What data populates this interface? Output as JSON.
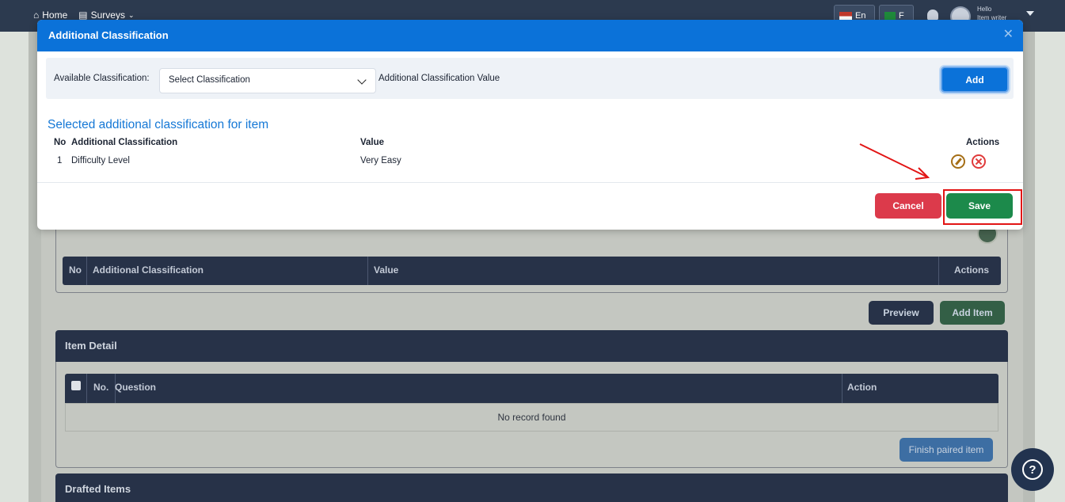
{
  "topbar": {
    "home": "Home",
    "surveys": "Surveys",
    "lang_en": "En",
    "lang_other": "F",
    "user_hello": "Hello",
    "user_name": "Item writer"
  },
  "background": {
    "table1_headers": [
      "No",
      "Additional Classification",
      "Value",
      "Actions"
    ],
    "preview_label": "Preview",
    "add_item_label": "Add Item",
    "item_detail_title": "Item Detail",
    "item_detail_headers": [
      "No.",
      "Question",
      "Action"
    ],
    "no_record": "No record found",
    "finish_paired_label": "Finish paired item",
    "drafted_items_title": "Drafted Items"
  },
  "modal": {
    "title": "Additional Classification",
    "available_label": "Available Classification:",
    "select_value": "Select Classification",
    "value_label": "Additional Classification Value",
    "add_label": "Add",
    "section_title": "Selected additional classification for item",
    "headers": {
      "no": "No",
      "classification": "Additional Classification",
      "value": "Value",
      "actions": "Actions"
    },
    "rows": [
      {
        "no": "1",
        "classification": "Difficulty Level",
        "value": "Very Easy"
      }
    ],
    "cancel_label": "Cancel",
    "save_label": "Save"
  },
  "colors": {
    "modal_header": "#0b72d9",
    "save": "#1c8a4b",
    "cancel": "#dc3a4b",
    "annotation": "#e21414"
  },
  "icons": [
    "home-icon",
    "surveys-icon",
    "bell-icon",
    "avatar",
    "close-icon",
    "chevron-down-icon",
    "edit-icon",
    "delete-icon",
    "help-icon",
    "plus-icon"
  ]
}
